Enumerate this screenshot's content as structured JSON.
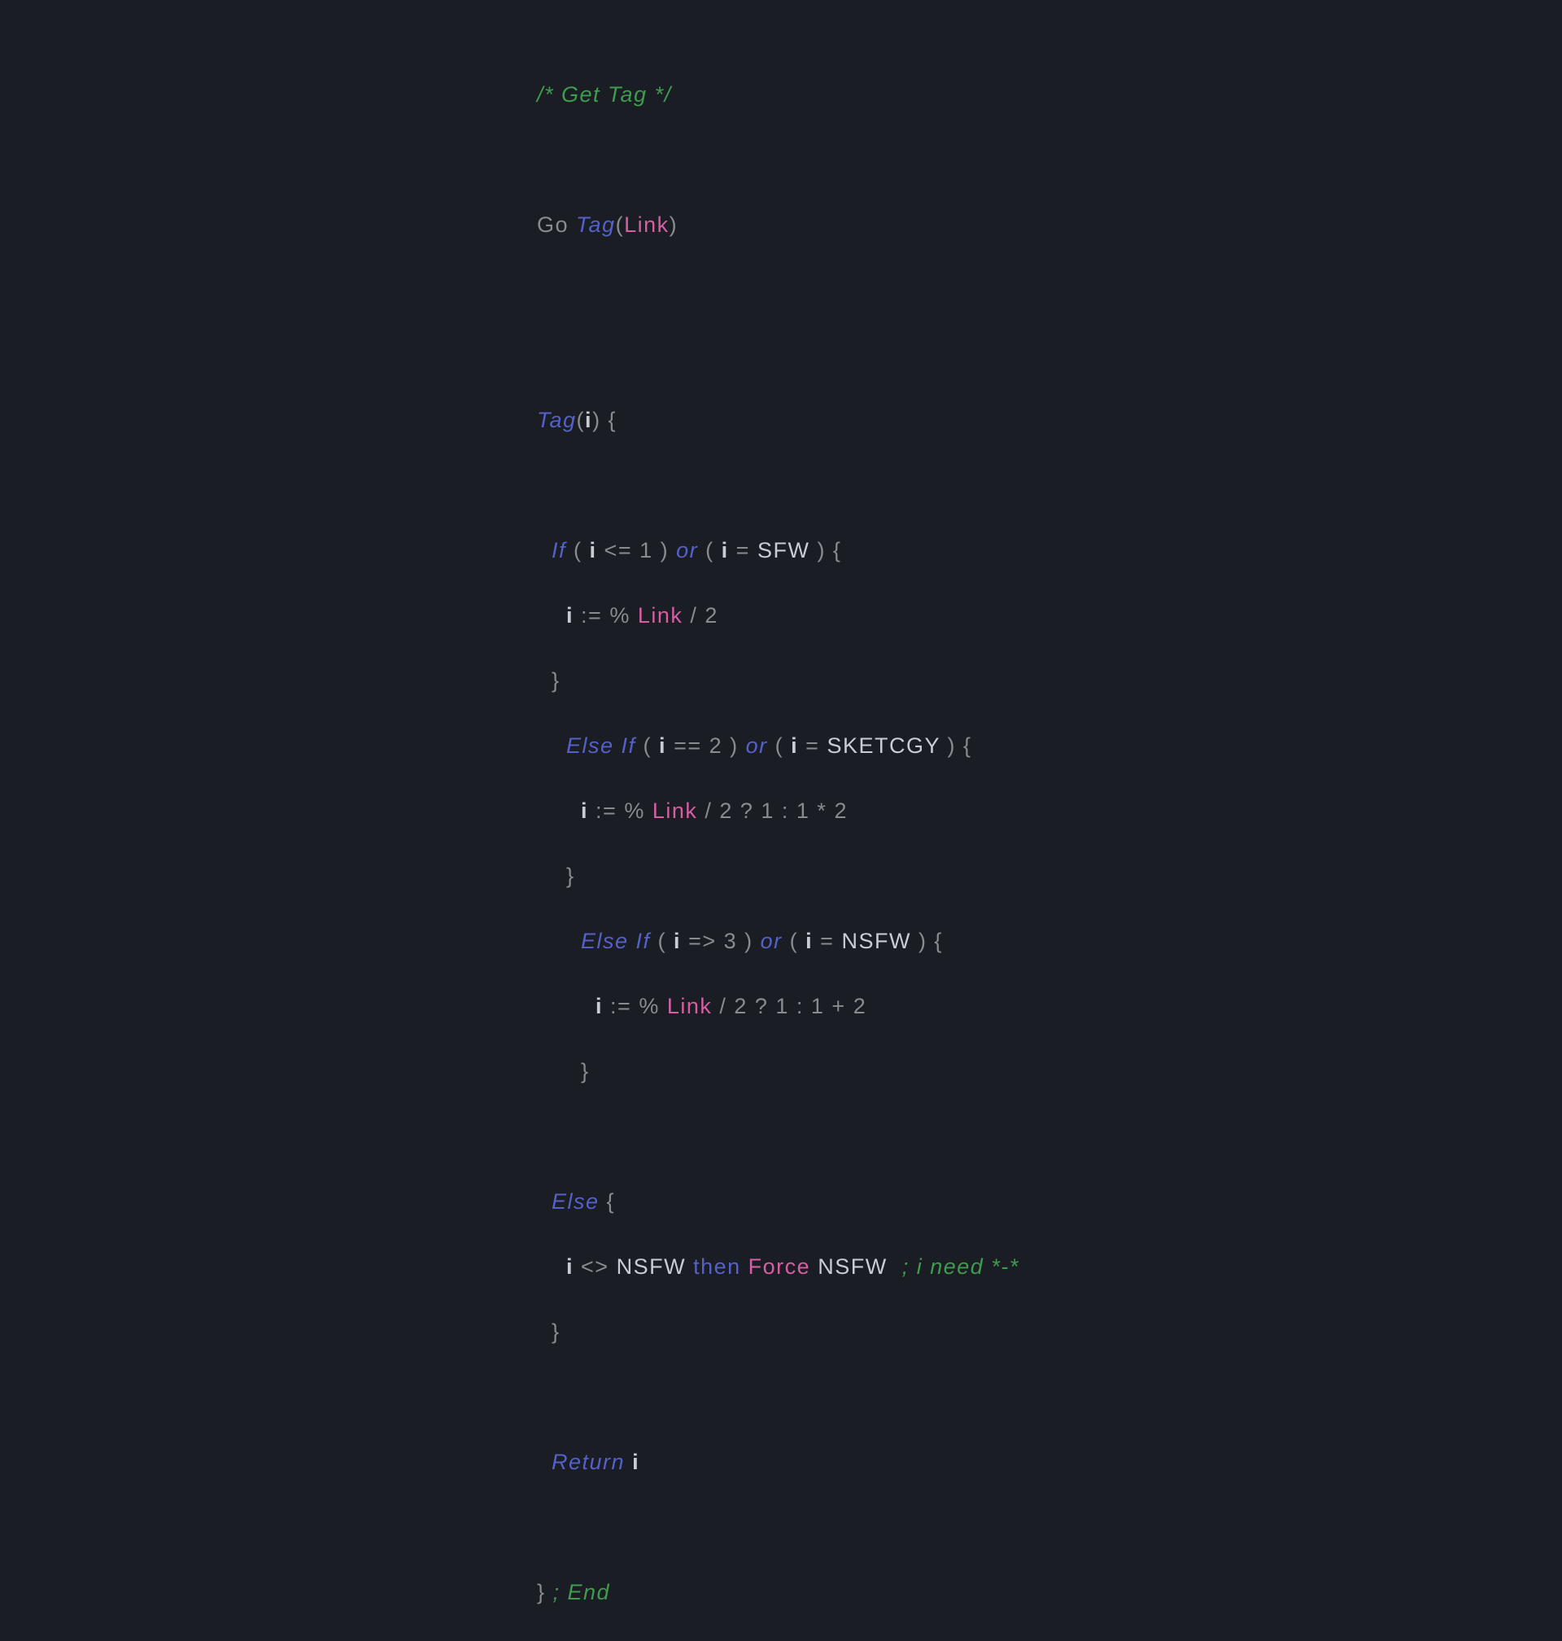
{
  "line1": {
    "comment": "/* Get Tag */"
  },
  "line2": {
    "go": "Go ",
    "tag": "Tag",
    "p1": "(",
    "link": "Link",
    "p2": ")"
  },
  "line3": {
    "tag": "Tag",
    "p1": "(",
    "i": "i",
    "rest": ") {"
  },
  "line4": {
    "pad": "  ",
    "if": "If",
    "p1": " ( ",
    "i1": "i",
    "op1": " <= ",
    "n1": "1",
    "p2": " ) ",
    "or": "or",
    "p3": " ( ",
    "i2": "i",
    "op2": " = ",
    "sfw": "SFW",
    "p4": " ) {"
  },
  "line5": {
    "pad": "    ",
    "i": "i",
    "op": " := ",
    "pct": "% ",
    "link": "Link",
    "rest": " / 2"
  },
  "line6": {
    "pad": "  ",
    "brace": "}"
  },
  "line7": {
    "pad": "    ",
    "elseif": "Else If",
    "p1": " ( ",
    "i1": "i",
    "op1": " == ",
    "n1": "2",
    "p2": " ) ",
    "or": "or",
    "p3": " ( ",
    "i2": "i",
    "op2": " = ",
    "sk": "SKETCGY",
    "p4": " ) {"
  },
  "line8": {
    "pad": "      ",
    "i": "i",
    "op": " := ",
    "pct": "% ",
    "link": "Link",
    "rest": " / 2 ? 1 : 1 * 2"
  },
  "line9": {
    "pad": "    ",
    "brace": "}"
  },
  "line10": {
    "pad": "      ",
    "elseif": "Else If",
    "p1": " ( ",
    "i1": "i",
    "op1": " => ",
    "n1": "3",
    "p2": " ) ",
    "or": "or",
    "p3": " ( ",
    "i2": "i",
    "op2": " = ",
    "nsfw": "NSFW",
    "p4": " ) {"
  },
  "line11": {
    "pad": "        ",
    "i": "i",
    "op": " := ",
    "pct": "% ",
    "link": "Link",
    "rest": " / 2 ? 1 : 1 + 2"
  },
  "line12": {
    "pad": "      ",
    "brace": "}"
  },
  "line13": {
    "pad": "  ",
    "else": "Else",
    "brace": " {"
  },
  "line14": {
    "pad": "    ",
    "i": "i",
    "op": " <> ",
    "nsfw1": "NSFW ",
    "then": "then",
    "sp": " ",
    "force": "Force",
    "sp2": " ",
    "nsfw2": "NSFW  ",
    "comment": "; i need *-*"
  },
  "line15": {
    "pad": "  ",
    "brace": "}"
  },
  "line16": {
    "pad": "  ",
    "ret": "Return",
    "sp": " ",
    "i": "i"
  },
  "line17": {
    "brace": "} ",
    "comment": "; End"
  }
}
